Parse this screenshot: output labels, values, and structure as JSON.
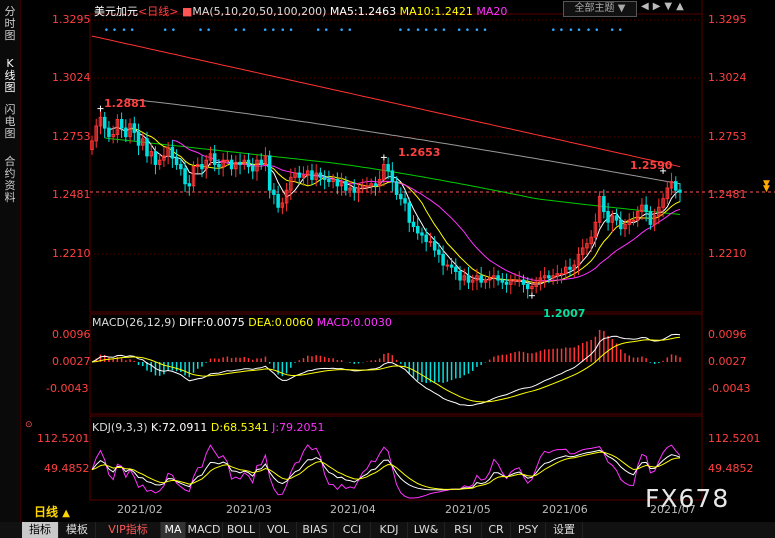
{
  "sidebar": {
    "tabs": [
      {
        "label": "分时图",
        "active": false
      },
      {
        "label": "K线图",
        "active": true
      },
      {
        "label": "闪电图",
        "active": false
      },
      {
        "label": "合约资料",
        "active": false
      }
    ]
  },
  "header": {
    "symbol": "美元加元",
    "period": "<日线>",
    "ma_params": "MA(5,10,20,50,100,200)",
    "ma5": "MA5:1.2463",
    "ma10": "MA10:1.2421",
    "ma20": "MA20"
  },
  "theme_button": {
    "label": "全部主题",
    "arrow": "▼"
  },
  "window_controls": [
    "◀",
    "▶",
    "▼",
    "▲"
  ],
  "main_axis": {
    "labels": [
      "1.3295",
      "1.3024",
      "1.2753",
      "1.2481",
      "1.2210"
    ],
    "current_price_marker": "▼"
  },
  "annotations": {
    "high1": "1.2881",
    "high2": "1.2653",
    "high3": "1.2590",
    "low1": "1.2007"
  },
  "macd": {
    "title": "MACD(26,12,9)",
    "diff": "DIFF:0.0075",
    "dea": "DEA:0.0060",
    "macd": "MACD:0.0030",
    "axis": [
      "0.0096",
      "0.0027",
      "-0.0043"
    ]
  },
  "kdj": {
    "title": "KDJ(9,3,3)",
    "k": "K:72.0911",
    "d": "D:68.5341",
    "j": "J:79.2051",
    "axis": [
      "112.5201",
      "49.4852"
    ],
    "corner_icon": "⊙"
  },
  "x_axis": {
    "period_label": "日线",
    "period_arrow": "▲",
    "dates": [
      "2021/02",
      "2021/03",
      "2021/04",
      "2021/05",
      "2021/06",
      "2021/07"
    ]
  },
  "watermark": "FX678",
  "toolbar": {
    "tabs": [
      {
        "label": "指标",
        "state": "active"
      },
      {
        "label": "模板",
        "state": "normal"
      },
      {
        "label": "VIP指标",
        "state": "vip"
      },
      {
        "label": "MA",
        "state": "hl"
      },
      {
        "label": "MACD",
        "state": "normal"
      },
      {
        "label": "BOLL",
        "state": "normal"
      },
      {
        "label": "VOL",
        "state": "normal"
      },
      {
        "label": "BIAS",
        "state": "normal"
      },
      {
        "label": "CCI",
        "state": "normal"
      },
      {
        "label": "KDJ",
        "state": "normal"
      },
      {
        "label": "LW&",
        "state": "normal"
      },
      {
        "label": "RSI",
        "state": "normal"
      },
      {
        "label": "CR",
        "state": "normal"
      },
      {
        "label": "PSY",
        "state": "normal"
      },
      {
        "label": "设置",
        "state": "normal"
      }
    ]
  },
  "colors": {
    "up": "#ff3333",
    "down": "#00e0e0",
    "ma5": "#ffffff",
    "ma10": "#ffff00",
    "ma20": "#ff33ff",
    "ma50": "#00cc00",
    "ma100": "#999999",
    "ma200": "#ff3333",
    "grid": "#5a0000"
  },
  "chart_data": {
    "type": "candlestick",
    "title": "美元加元 <日线>",
    "x_ticks": [
      "2021/02",
      "2021/03",
      "2021/04",
      "2021/05",
      "2021/06",
      "2021/07"
    ],
    "ylim": [
      1.19,
      1.345
    ],
    "y_ticks": [
      1.3295,
      1.3024,
      1.2753,
      1.2481,
      1.221
    ],
    "marked_points": [
      {
        "label": "1.2881",
        "date_index": 2,
        "value": 1.2881
      },
      {
        "label": "1.2653",
        "date_index": 69,
        "value": 1.2653
      },
      {
        "label": "1.2007",
        "date_index": 104,
        "value": 1.2007
      },
      {
        "label": "1.2590",
        "date_index": 135,
        "value": 1.259
      }
    ],
    "closes": [
      1.273,
      1.28,
      1.284,
      1.279,
      1.275,
      1.276,
      1.283,
      1.279,
      1.275,
      1.281,
      1.277,
      1.271,
      1.274,
      1.266,
      1.268,
      1.262,
      1.264,
      1.266,
      1.27,
      1.265,
      1.262,
      1.26,
      1.253,
      1.252,
      1.261,
      1.262,
      1.26,
      1.264,
      1.267,
      1.262,
      1.261,
      1.264,
      1.264,
      1.26,
      1.263,
      1.262,
      1.264,
      1.261,
      1.259,
      1.264,
      1.262,
      1.266,
      1.25,
      1.248,
      1.242,
      1.244,
      1.25,
      1.256,
      1.258,
      1.256,
      1.257,
      1.259,
      1.255,
      1.258,
      1.256,
      1.255,
      1.254,
      1.255,
      1.252,
      1.254,
      1.25,
      1.251,
      1.249,
      1.251,
      1.252,
      1.252,
      1.253,
      1.252,
      1.255,
      1.262,
      1.259,
      1.254,
      1.248,
      1.246,
      1.244,
      1.235,
      1.233,
      1.23,
      1.229,
      1.226,
      1.226,
      1.222,
      1.22,
      1.215,
      1.215,
      1.214,
      1.212,
      1.208,
      1.21,
      1.207,
      1.208,
      1.21,
      1.207,
      1.208,
      1.209,
      1.21,
      1.208,
      1.207,
      1.206,
      1.208,
      1.208,
      1.208,
      1.206,
      1.204,
      1.205,
      1.207,
      1.209,
      1.21,
      1.209,
      1.21,
      1.211,
      1.211,
      1.214,
      1.213,
      1.215,
      1.22,
      1.223,
      1.225,
      1.228,
      1.235,
      1.247,
      1.24,
      1.235,
      1.238,
      1.236,
      1.232,
      1.234,
      1.236,
      1.236,
      1.24,
      1.243,
      1.24,
      1.234,
      1.238,
      1.242,
      1.246,
      1.251,
      1.254,
      1.25,
      1.249
    ],
    "series_ma": [
      {
        "name": "MA5",
        "values": [
          1.2463
        ]
      },
      {
        "name": "MA10",
        "values": [
          1.2421
        ]
      },
      {
        "name": "MA20",
        "values": []
      }
    ]
  }
}
